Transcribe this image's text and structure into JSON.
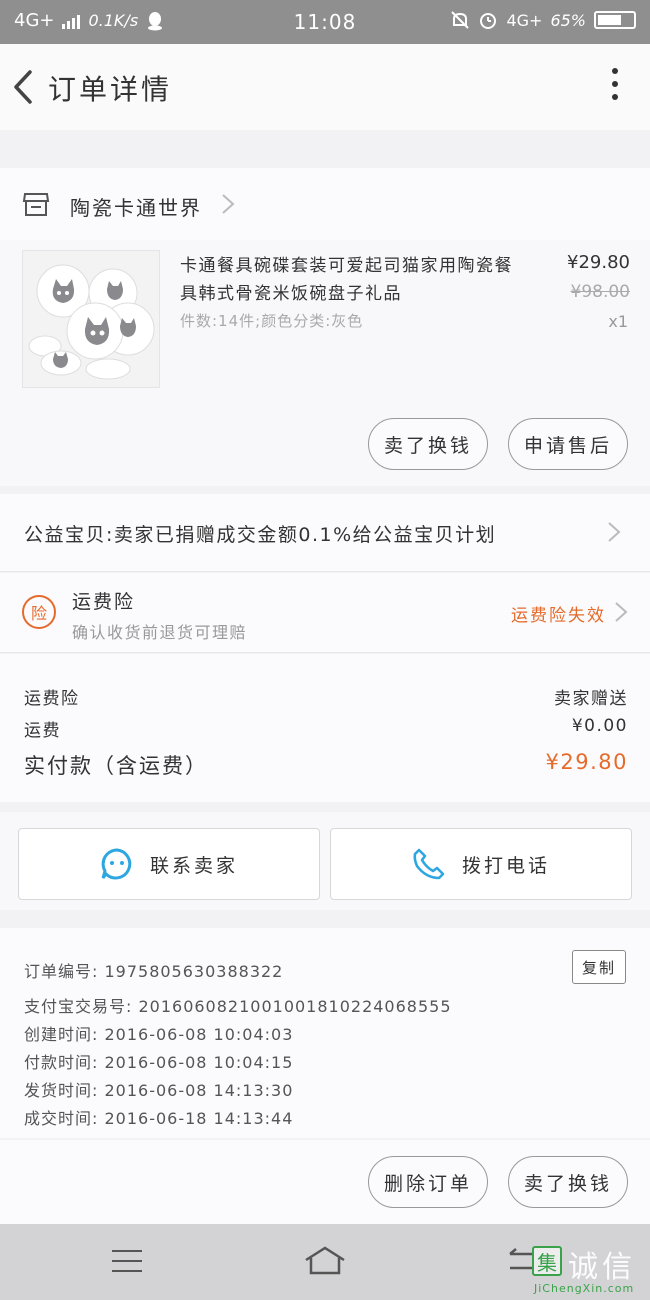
{
  "status_bar": {
    "network_left": "4G+",
    "speed": "0.1K/s",
    "time": "11:08",
    "network_right": "4G+",
    "battery": "65%"
  },
  "header": {
    "title": "订单详情"
  },
  "shop": {
    "name": "陶瓷卡通世界"
  },
  "product": {
    "title": "卡通餐具碗碟套装可爱起司猫家用陶瓷餐具韩式骨瓷米饭碗盘子礼品",
    "spec": "件数:14件;颜色分类:灰色",
    "price": "¥29.80",
    "original_price": "¥98.00",
    "quantity": "x1",
    "buttons": {
      "resell": "卖了换钱",
      "after_sale": "申请售后"
    }
  },
  "charity": {
    "text": "公益宝贝:卖家已捐赠成交金额0.1%给公益宝贝计划"
  },
  "insurance": {
    "badge": "险",
    "name": "运费险",
    "description": "确认收货前退货可理赔",
    "status": "运费险失效",
    "status_color": "#e56b2b"
  },
  "fees": {
    "insurance_label": "运费险",
    "insurance_value": "卖家赠送",
    "shipping_label": "运费",
    "shipping_value": "¥0.00",
    "total_label": "实付款（含运费）",
    "total_value": "¥29.80"
  },
  "contact": {
    "seller_label": "联系卖家",
    "call_label": "拨打电话"
  },
  "order_info": {
    "order_number": "订单编号: 1975805630388322",
    "alipay_number": "支付宝交易号: 2016060821001001810224068555",
    "created": "创建时间: 2016-06-08 10:04:03",
    "paid": "付款时间: 2016-06-08 10:04:15",
    "shipped": "发货时间: 2016-06-08 14:13:30",
    "completed": "成交时间: 2016-06-18 14:13:44",
    "copy_label": "复制"
  },
  "actions": {
    "delete_label": "删除订单",
    "resell_label": "卖了换钱"
  },
  "watermark": {
    "logo_char": "集",
    "text": "诚信",
    "domain": "JiChengXin.com"
  },
  "colors": {
    "accent": "#e56b2b",
    "contact_icon": "#2ea7e0"
  }
}
